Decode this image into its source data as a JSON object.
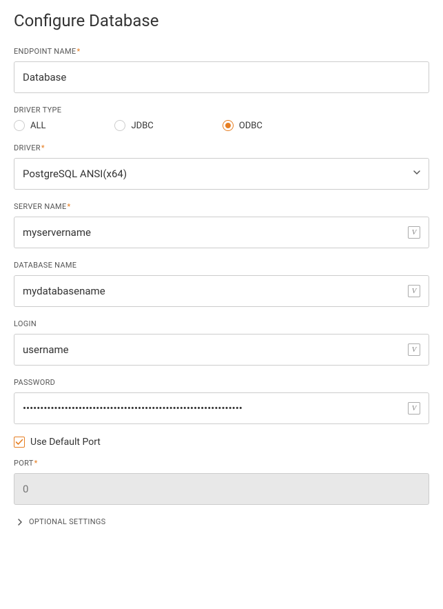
{
  "title": "Configure Database",
  "fields": {
    "endpoint_name": {
      "label": "ENDPOINT NAME",
      "value": "Database"
    },
    "driver_type": {
      "label": "DRIVER TYPE",
      "options": {
        "all": "ALL",
        "jdbc": "JDBC",
        "odbc": "ODBC"
      },
      "selected": "odbc"
    },
    "driver": {
      "label": "DRIVER",
      "value": "PostgreSQL ANSI(x64)"
    },
    "server_name": {
      "label": "SERVER NAME",
      "value": "myservername"
    },
    "database_name": {
      "label": "DATABASE NAME",
      "value": "mydatabasename"
    },
    "login": {
      "label": "LOGIN",
      "value": "username"
    },
    "password": {
      "label": "PASSWORD",
      "value": "•••••••••••••••••••••••••••••••••••••••••••••••••••••••••••••••"
    },
    "use_default_port": {
      "label": "Use Default Port",
      "checked": true
    },
    "port": {
      "label": "PORT",
      "placeholder": "0",
      "value": ""
    }
  },
  "optional_settings_label": "OPTIONAL SETTINGS",
  "var_icon_text": "V"
}
